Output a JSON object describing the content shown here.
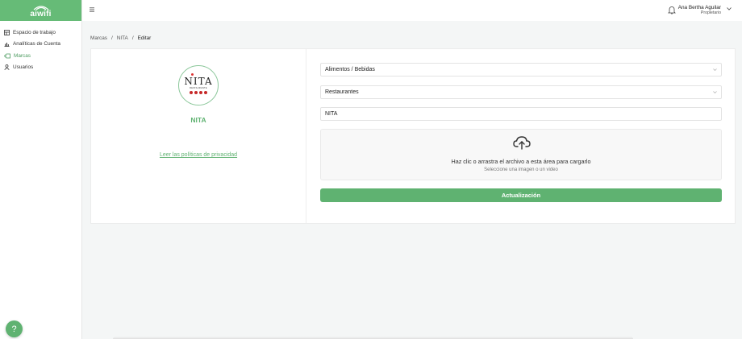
{
  "brand": {
    "name": "aiwifi",
    "color": "#66bb77"
  },
  "sidebar": {
    "items": [
      {
        "label": "Espacio de trabajo",
        "icon": "workspace-icon",
        "active": false
      },
      {
        "label": "Analíticas de Cuenta",
        "icon": "bar-chart-icon",
        "active": false
      },
      {
        "label": "Marcas",
        "icon": "tag-icon",
        "active": true
      },
      {
        "label": "Usuarios",
        "icon": "user-icon",
        "active": false
      }
    ]
  },
  "header": {
    "user_name": "Ana Bertha Aguilar",
    "user_role": "Propietario"
  },
  "breadcrumb": [
    "Marcas",
    "NITA",
    "Editar"
  ],
  "brand_card": {
    "logo_word": "NITA",
    "logo_sub": "RESTAURANTE",
    "name": "NITA",
    "privacy_link": "Leer las políticas de privacidad"
  },
  "form": {
    "category": "Alimentos / Bebidas",
    "subcategory": "Restaurantes",
    "name_value": "NITA",
    "upload_title": "Haz clic o arrastra el archivo a esta área para cargarlo",
    "upload_hint": "Seleccione una imagen o un video",
    "submit_label": "Actualización"
  },
  "help_label": "?",
  "colors": {
    "accent": "#5fb271",
    "sidebar_header": "#66bb77"
  }
}
